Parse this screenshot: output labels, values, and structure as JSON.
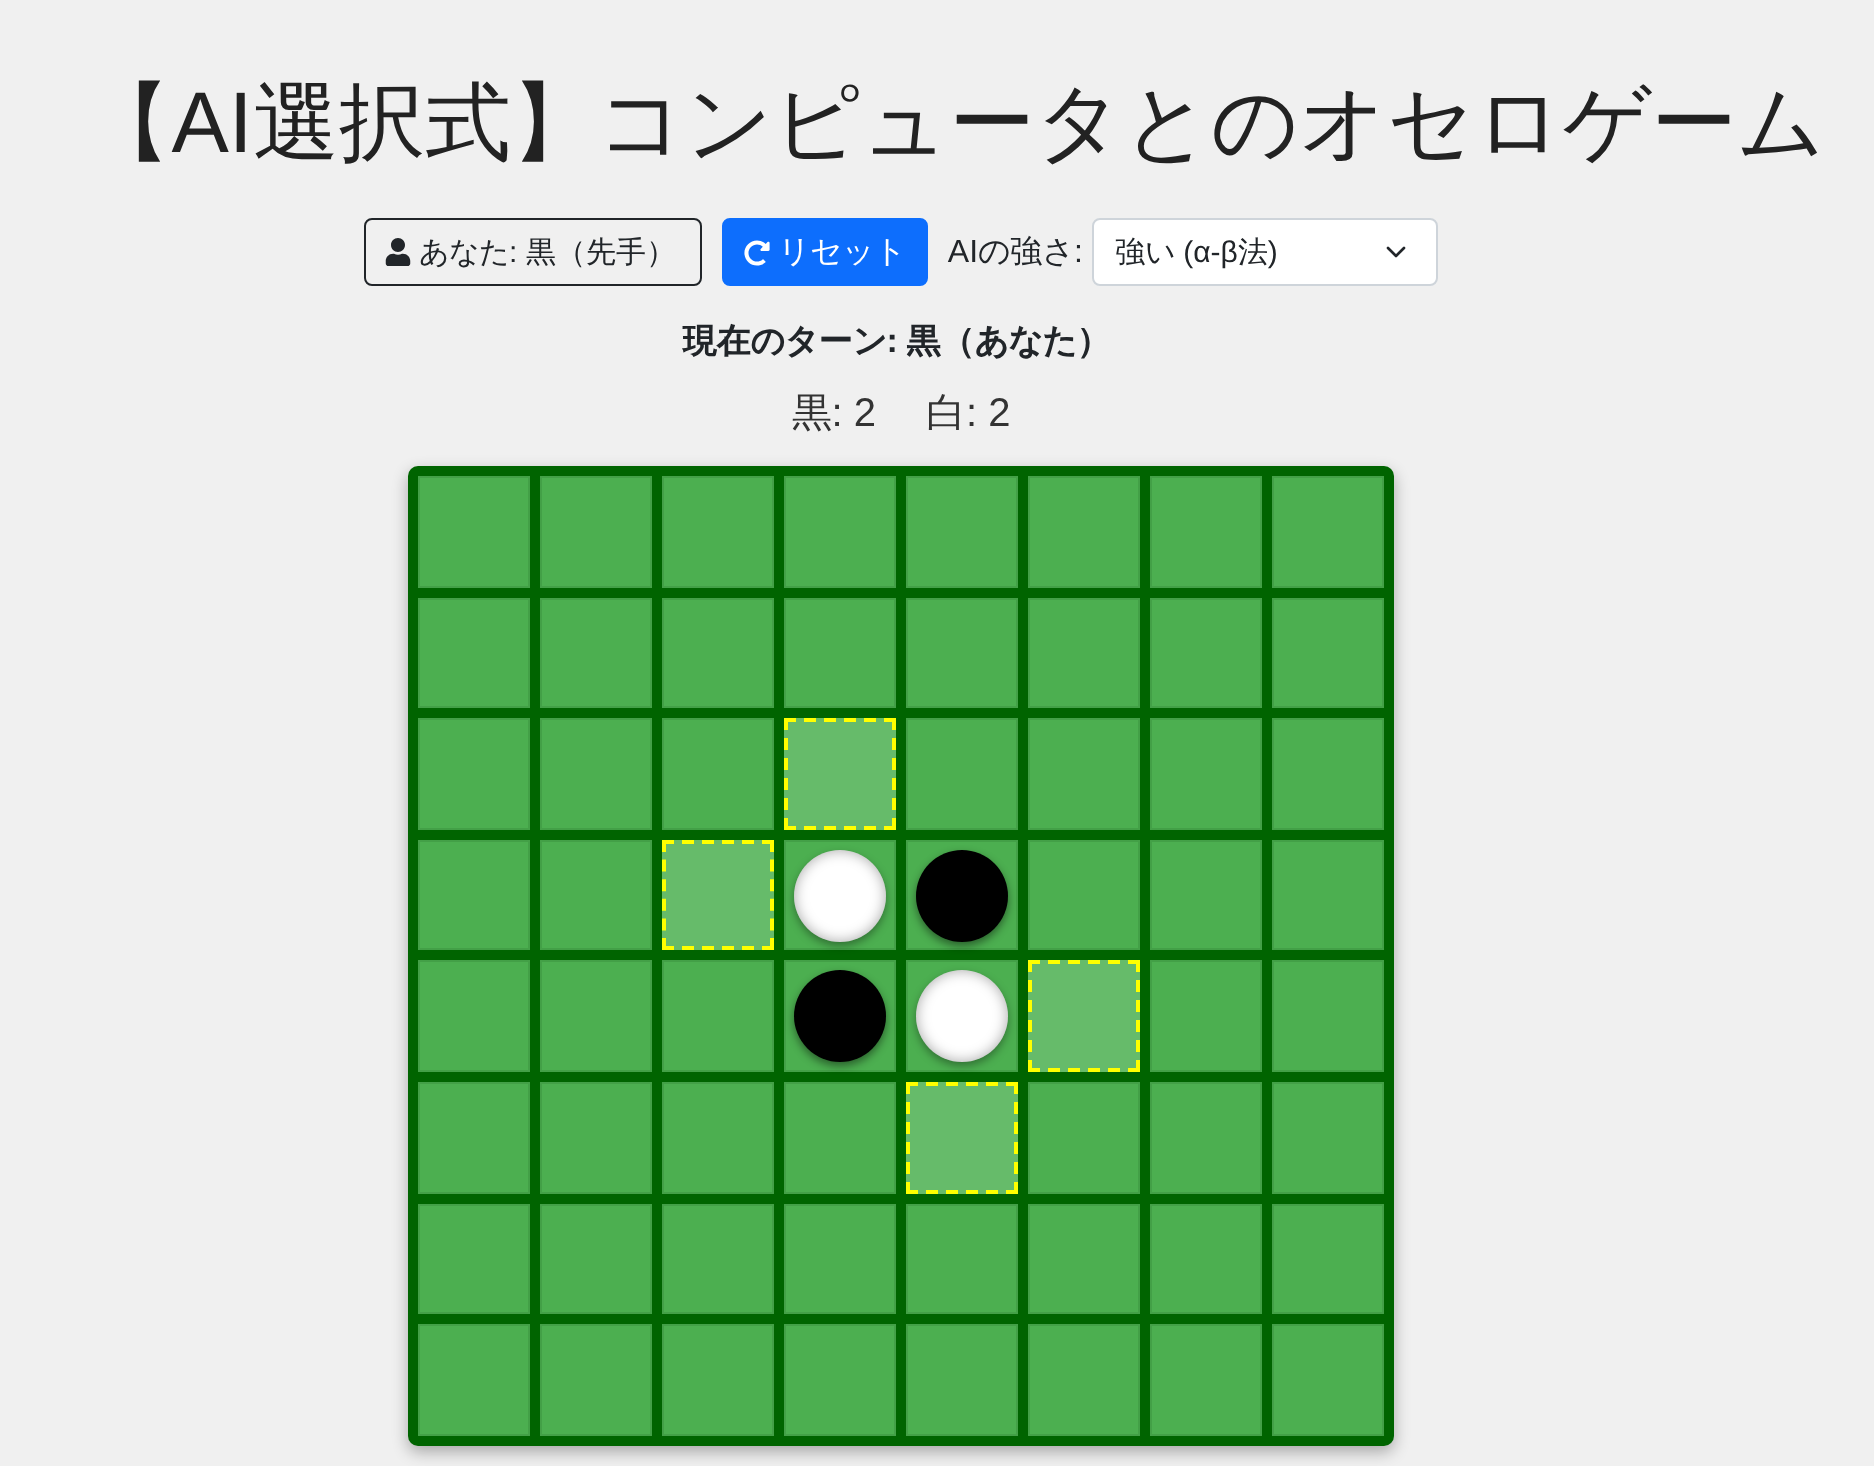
{
  "title": "【AI選択式】コンピュータとのオセロゲーム",
  "controls": {
    "player_button": "あなた: 黒（先手）",
    "reset_button": "リセット",
    "difficulty_label": "AIの強さ:",
    "difficulty_select": "強い (α-β法)"
  },
  "turn": "現在のターン: 黒（あなた）",
  "score": {
    "black": "黒: 2",
    "white": "白: 2"
  },
  "board": {
    "rows": [
      [
        {
          "kind": "empty",
          "highlighted": false
        },
        {
          "kind": "empty",
          "highlighted": false
        },
        {
          "kind": "empty",
          "highlighted": false
        },
        {
          "kind": "empty",
          "highlighted": false
        },
        {
          "kind": "empty",
          "highlighted": false
        },
        {
          "kind": "empty",
          "highlighted": false
        },
        {
          "kind": "empty",
          "highlighted": false
        },
        {
          "kind": "empty",
          "highlighted": false
        }
      ],
      [
        {
          "kind": "empty",
          "highlighted": false
        },
        {
          "kind": "empty",
          "highlighted": false
        },
        {
          "kind": "empty",
          "highlighted": false
        },
        {
          "kind": "empty",
          "highlighted": false
        },
        {
          "kind": "empty",
          "highlighted": false
        },
        {
          "kind": "empty",
          "highlighted": false
        },
        {
          "kind": "empty",
          "highlighted": false
        },
        {
          "kind": "empty",
          "highlighted": false
        }
      ],
      [
        {
          "kind": "empty",
          "highlighted": false
        },
        {
          "kind": "empty",
          "highlighted": false
        },
        {
          "kind": "empty",
          "highlighted": false
        },
        {
          "kind": "empty",
          "highlighted": true
        },
        {
          "kind": "empty",
          "highlighted": false
        },
        {
          "kind": "empty",
          "highlighted": false
        },
        {
          "kind": "empty",
          "highlighted": false
        },
        {
          "kind": "empty",
          "highlighted": false
        }
      ],
      [
        {
          "kind": "empty",
          "highlighted": false
        },
        {
          "kind": "empty",
          "highlighted": false
        },
        {
          "kind": "empty",
          "highlighted": true
        },
        {
          "kind": "white",
          "highlighted": false
        },
        {
          "kind": "black",
          "highlighted": false
        },
        {
          "kind": "empty",
          "highlighted": false
        },
        {
          "kind": "empty",
          "highlighted": false
        },
        {
          "kind": "empty",
          "highlighted": false
        }
      ],
      [
        {
          "kind": "empty",
          "highlighted": false
        },
        {
          "kind": "empty",
          "highlighted": false
        },
        {
          "kind": "empty",
          "highlighted": false
        },
        {
          "kind": "black",
          "highlighted": false
        },
        {
          "kind": "white",
          "highlighted": false
        },
        {
          "kind": "empty",
          "highlighted": true
        },
        {
          "kind": "empty",
          "highlighted": false
        },
        {
          "kind": "empty",
          "highlighted": false
        }
      ],
      [
        {
          "kind": "empty",
          "highlighted": false
        },
        {
          "kind": "empty",
          "highlighted": false
        },
        {
          "kind": "empty",
          "highlighted": false
        },
        {
          "kind": "empty",
          "highlighted": false
        },
        {
          "kind": "empty",
          "highlighted": true
        },
        {
          "kind": "empty",
          "highlighted": false
        },
        {
          "kind": "empty",
          "highlighted": false
        },
        {
          "kind": "empty",
          "highlighted": false
        }
      ],
      [
        {
          "kind": "empty",
          "highlighted": false
        },
        {
          "kind": "empty",
          "highlighted": false
        },
        {
          "kind": "empty",
          "highlighted": false
        },
        {
          "kind": "empty",
          "highlighted": false
        },
        {
          "kind": "empty",
          "highlighted": false
        },
        {
          "kind": "empty",
          "highlighted": false
        },
        {
          "kind": "empty",
          "highlighted": false
        },
        {
          "kind": "empty",
          "highlighted": false
        }
      ],
      [
        {
          "kind": "empty",
          "highlighted": false
        },
        {
          "kind": "empty",
          "highlighted": false
        },
        {
          "kind": "empty",
          "highlighted": false
        },
        {
          "kind": "empty",
          "highlighted": false
        },
        {
          "kind": "empty",
          "highlighted": false
        },
        {
          "kind": "empty",
          "highlighted": false
        },
        {
          "kind": "empty",
          "highlighted": false
        },
        {
          "kind": "empty",
          "highlighted": false
        }
      ]
    ]
  }
}
